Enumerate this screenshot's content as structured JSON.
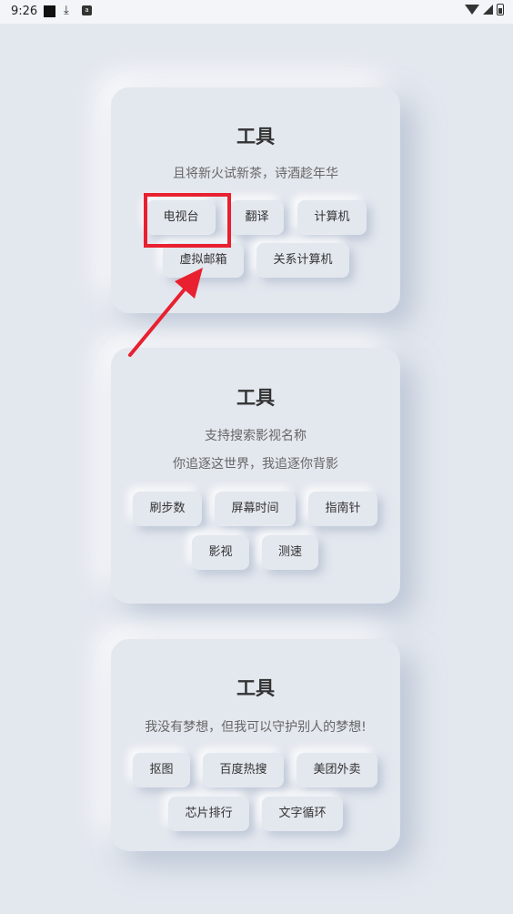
{
  "status_bar": {
    "time": "9:26",
    "icons": [
      "black-square-icon",
      "download-icon",
      "app-icon",
      "wifi-icon",
      "signal-icon",
      "battery-icon"
    ]
  },
  "cards": [
    {
      "title": "工具",
      "subtitles": [
        "且将新火试新茶，诗酒趁年华"
      ],
      "buttons": [
        "电视台",
        "翻译",
        "计算机",
        "虚拟邮箱",
        "关系计算机"
      ]
    },
    {
      "title": "工具",
      "subtitles": [
        "支持搜索影视名称",
        "你追逐这世界，我追逐你背影"
      ],
      "buttons": [
        "刷步数",
        "屏幕时间",
        "指南针",
        "影视",
        "测速"
      ]
    },
    {
      "title": "工具",
      "subtitles": [
        "我没有梦想，但我可以守护别人的梦想!"
      ],
      "buttons": [
        "抠图",
        "百度热搜",
        "美团外卖",
        "芯片排行",
        "文字循环"
      ]
    }
  ],
  "annotation": {
    "color": "#e8202f",
    "target": "电视台"
  }
}
